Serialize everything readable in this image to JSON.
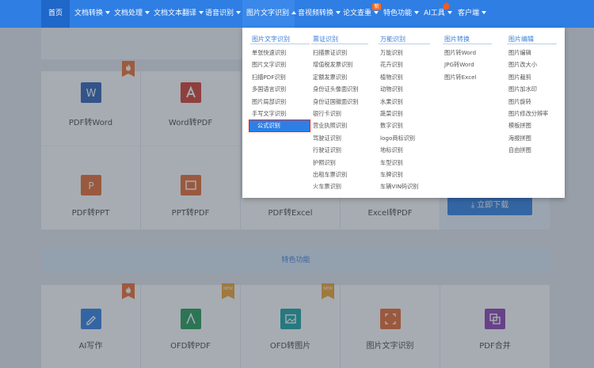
{
  "nav": {
    "items": [
      {
        "label": "首页"
      },
      {
        "label": "文档转换"
      },
      {
        "label": "文档处理"
      },
      {
        "label": "文档文本翻译"
      },
      {
        "label": "语音识别"
      },
      {
        "label": "图片文字识别"
      },
      {
        "label": "音视频转换"
      },
      {
        "label": "论文查重"
      },
      {
        "label": "特色功能"
      },
      {
        "label": "AI工具"
      },
      {
        "label": "客户端"
      }
    ],
    "new_badge": "新"
  },
  "dropdown": {
    "columns": [
      {
        "header": "图片文字识别",
        "items": [
          "单张快速识别",
          "图片文字识别",
          "扫描PDF识别",
          "多国语言识别",
          "图片局部识别",
          "手写文字识别",
          "公式识别"
        ]
      },
      {
        "header": "票证识别",
        "items": [
          "扫描票证识别",
          "增值税发票识别",
          "定额发票识别",
          "身份证头像面识别",
          "身份证国徽面识别",
          "银行卡识别",
          "营业执照识别",
          "驾驶证识别",
          "行驶证识别",
          "护照识别",
          "出租车票识别",
          "火车票识别"
        ]
      },
      {
        "header": "万能识别",
        "items": [
          "万能识别",
          "花卉识别",
          "植物识别",
          "动物识别",
          "水果识别",
          "蔬菜识别",
          "数字识别",
          "logo商标识别",
          "地标识别",
          "车型识别",
          "车牌识别",
          "车辆VIN码识别"
        ]
      },
      {
        "header": "图片转换",
        "items": [
          "图片转Word",
          "JPG转Word",
          "图片转Excel"
        ]
      },
      {
        "header": "图片编辑",
        "items": [
          "图片编辑",
          "图片改大小",
          "图片裁剪",
          "图片加水印",
          "图片旋转",
          "图片修改分辨率",
          "模板拼图",
          "海报拼图",
          "自由拼图"
        ]
      }
    ],
    "selected_item": "公式识别"
  },
  "cards_row1": [
    {
      "label": "PDF转Word",
      "icon": "word-icon",
      "color": "#2b5fb4"
    },
    {
      "label": "Word转PDF",
      "icon": "pdf-icon",
      "color": "#d43a2c"
    }
  ],
  "cards_row2": [
    {
      "label": "PDF转PPT",
      "icon": "ppt-icon",
      "color": "#e8692d"
    },
    {
      "label": "PPT转PDF",
      "icon": "ppt-pdf-icon",
      "color": "#e8692d"
    },
    {
      "label": "PDF转Excel",
      "icon": "excel-icon",
      "color": "#1f8a4c"
    },
    {
      "label": "Excel转PDF",
      "icon": "excel-pdf-icon",
      "color": "#1f8a4c"
    }
  ],
  "download_button": {
    "label": "立即下载"
  },
  "section_title": "特色功能",
  "cards_row3": [
    {
      "label": "AI写作",
      "icon": "pen-icon",
      "color": "#2f7ee3"
    },
    {
      "label": "OFD转PDF",
      "icon": "ofd-pdf-icon",
      "color": "#1f9a55"
    },
    {
      "label": "OFD转图片",
      "icon": "ofd-image-icon",
      "color": "#14a3a3"
    },
    {
      "label": "图片文字识别",
      "icon": "ocr-icon",
      "color": "#e8692d"
    },
    {
      "label": "PDF合并",
      "icon": "merge-icon",
      "color": "#8b3fb3"
    }
  ],
  "badges": {
    "new": "NEW"
  }
}
